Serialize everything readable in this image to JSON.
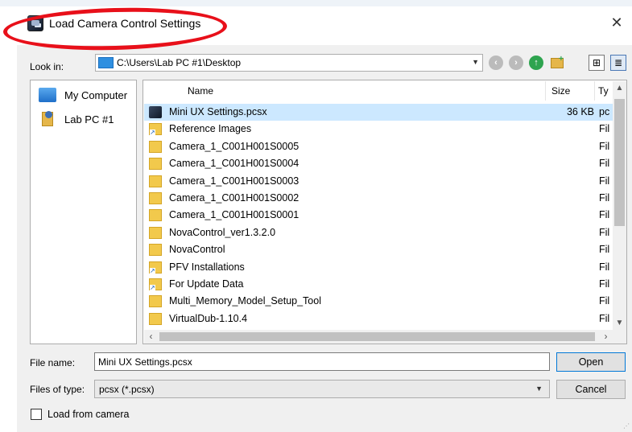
{
  "window": {
    "title": "Load Camera Control Settings",
    "close_glyph": "✕"
  },
  "lookin": {
    "label": "Look in:",
    "path": "C:\\Users\\Lab PC #1\\Desktop"
  },
  "places": [
    {
      "label": "My Computer",
      "icon": "computer-icon"
    },
    {
      "label": "Lab PC #1",
      "icon": "user-folder-icon"
    }
  ],
  "columns": {
    "name": "Name",
    "size": "Size",
    "type": "Ty"
  },
  "files": [
    {
      "name": "Mini UX Settings.pcsx",
      "size": "36 KB",
      "type": "pc",
      "icon": "pcsx-file-icon",
      "selected": true
    },
    {
      "name": "Reference Images",
      "size": "",
      "type": "Fil",
      "icon": "shortcut-folder-icon"
    },
    {
      "name": "Camera_1_C001H001S0005",
      "size": "",
      "type": "Fil",
      "icon": "folder-icon"
    },
    {
      "name": "Camera_1_C001H001S0004",
      "size": "",
      "type": "Fil",
      "icon": "folder-icon"
    },
    {
      "name": "Camera_1_C001H001S0003",
      "size": "",
      "type": "Fil",
      "icon": "folder-icon"
    },
    {
      "name": "Camera_1_C001H001S0002",
      "size": "",
      "type": "Fil",
      "icon": "folder-icon"
    },
    {
      "name": "Camera_1_C001H001S0001",
      "size": "",
      "type": "Fil",
      "icon": "folder-icon"
    },
    {
      "name": "NovaControl_ver1.3.2.0",
      "size": "",
      "type": "Fil",
      "icon": "folder-icon"
    },
    {
      "name": "NovaControl",
      "size": "",
      "type": "Fil",
      "icon": "folder-icon"
    },
    {
      "name": "PFV Installations",
      "size": "",
      "type": "Fil",
      "icon": "shortcut-folder-icon"
    },
    {
      "name": "For Update Data",
      "size": "",
      "type": "Fil",
      "icon": "shortcut-folder-icon"
    },
    {
      "name": "Multi_Memory_Model_Setup_Tool",
      "size": "",
      "type": "Fil",
      "icon": "folder-icon"
    },
    {
      "name": "VirtualDub-1.10.4",
      "size": "",
      "type": "Fil",
      "icon": "folder-icon"
    }
  ],
  "filename": {
    "label": "File name:",
    "value": "Mini UX Settings.pcsx"
  },
  "filetype": {
    "label": "Files of type:",
    "value": "pcsx (*.pcsx)"
  },
  "buttons": {
    "open": "Open",
    "cancel": "Cancel"
  },
  "checkbox": {
    "label": "Load from camera",
    "checked": false
  },
  "colors": {
    "selection": "#cce8ff",
    "annotation_ellipse": "#e8101a",
    "default_button_border": "#0078d7"
  }
}
